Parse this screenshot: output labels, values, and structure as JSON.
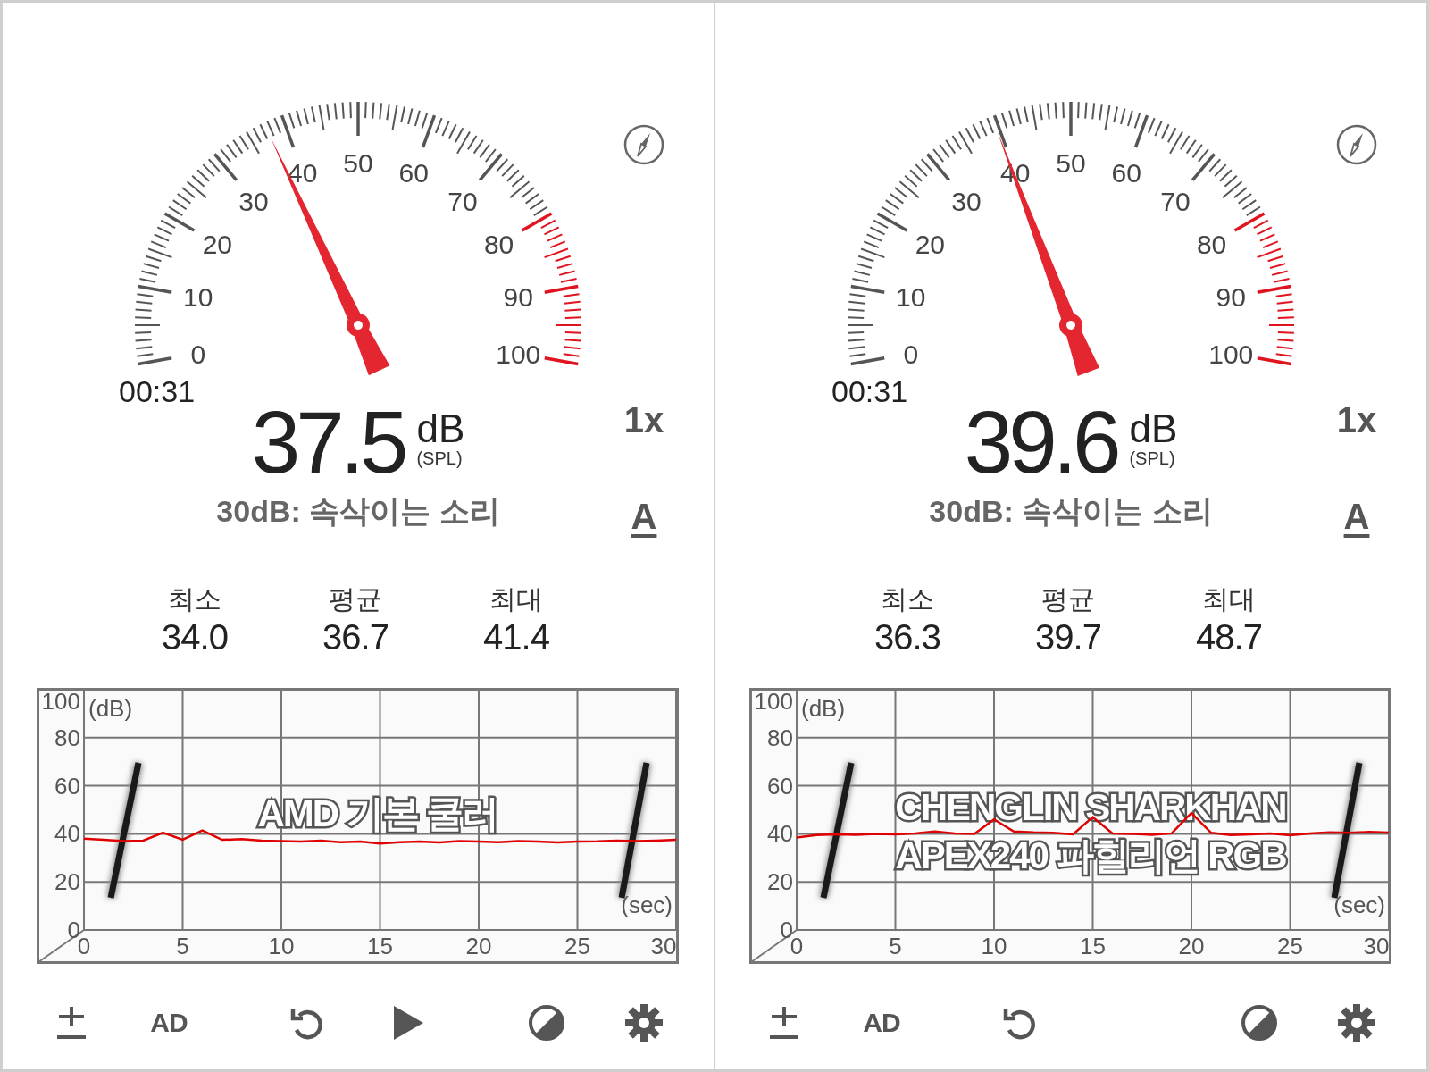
{
  "panels": [
    {
      "timer": "00:31",
      "gauge": {
        "level": 0.375,
        "labels": [
          "50",
          "40",
          "60",
          "30",
          "70",
          "20",
          "80",
          "10",
          "90",
          "0",
          "100"
        ]
      },
      "reading": "37.5",
      "unit": "dB",
      "unit_note": "(SPL)",
      "reference": "30dB: 속삭이는 소리",
      "zoom": "1x",
      "weighting": "A",
      "stats": [
        {
          "label": "최소",
          "value": "34.0"
        },
        {
          "label": "평균",
          "value": "36.7"
        },
        {
          "label": "최대",
          "value": "41.4"
        }
      ],
      "chart": {
        "annotation": [
          "AMD 기본 쿨러"
        ],
        "chart_data": {
          "type": "line",
          "xlabel": "(sec)",
          "ylabel": "(dB)",
          "x": [
            0,
            1,
            2,
            3,
            4,
            5,
            6,
            7,
            8,
            9,
            10,
            11,
            12,
            13,
            14,
            15,
            16,
            17,
            18,
            19,
            20,
            21,
            22,
            23,
            24,
            25,
            26,
            27,
            28,
            29,
            30
          ],
          "xlim": [
            0,
            30
          ],
          "ylim": [
            0,
            100
          ],
          "xticks": [
            0,
            5,
            10,
            15,
            20,
            25,
            30
          ],
          "yticks": [
            0,
            20,
            40,
            60,
            80,
            100
          ],
          "grid": true,
          "series": [
            {
              "color": "#e00000",
              "values": [
                38,
                37.5,
                37,
                37.2,
                40.5,
                37.6,
                41.4,
                37.5,
                37.8,
                37.2,
                37,
                36.8,
                37.2,
                36.5,
                36.8,
                36,
                36.5,
                36.8,
                36.4,
                37,
                36.8,
                36.5,
                37,
                36.8,
                36.4,
                36.8,
                36.9,
                37.2,
                37,
                37.2,
                37.5
              ]
            }
          ]
        }
      },
      "toolbar": [
        {
          "kind": "plus-minus"
        },
        {
          "kind": "ad",
          "label": "AD"
        },
        {
          "kind": "reset"
        },
        {
          "kind": "play"
        },
        {
          "kind": "contrast"
        },
        {
          "kind": "settings"
        }
      ]
    },
    {
      "timer": "00:31",
      "gauge": {
        "level": 0.396,
        "labels": [
          "50",
          "40",
          "60",
          "30",
          "70",
          "20",
          "80",
          "10",
          "90",
          "0",
          "100"
        ]
      },
      "reading": "39.6",
      "unit": "dB",
      "unit_note": "(SPL)",
      "reference": "30dB: 속삭이는 소리",
      "zoom": "1x",
      "weighting": "A",
      "stats": [
        {
          "label": "최소",
          "value": "36.3"
        },
        {
          "label": "평균",
          "value": "39.7"
        },
        {
          "label": "최대",
          "value": "48.7"
        }
      ],
      "chart": {
        "annotation": [
          "CHENGLIN SHARKHAN",
          "APEX240 파힐리언 RGB"
        ],
        "chart_data": {
          "type": "line",
          "xlabel": "(sec)",
          "ylabel": "(dB)",
          "x": [
            0,
            1,
            2,
            3,
            4,
            5,
            6,
            7,
            8,
            9,
            10,
            11,
            12,
            13,
            14,
            15,
            16,
            17,
            18,
            19,
            20,
            21,
            22,
            23,
            24,
            25,
            26,
            27,
            28,
            29,
            30
          ],
          "xlim": [
            0,
            30
          ],
          "ylim": [
            0,
            100
          ],
          "xticks": [
            0,
            5,
            10,
            15,
            20,
            25,
            30
          ],
          "yticks": [
            0,
            20,
            40,
            60,
            80,
            100
          ],
          "grid": true,
          "series": [
            {
              "color": "#e00000",
              "values": [
                38.5,
                39.5,
                39.8,
                39.6,
                40,
                39.8,
                40.2,
                41,
                40.2,
                40,
                46,
                41,
                40.6,
                40.4,
                39.8,
                47,
                40.2,
                40,
                39.6,
                40.2,
                48.7,
                40.4,
                39.5,
                39.8,
                40.2,
                39.4,
                40.2,
                40.6,
                40.4,
                40.8,
                40.5
              ]
            }
          ]
        }
      },
      "toolbar": [
        {
          "kind": "plus-minus"
        },
        {
          "kind": "ad",
          "label": "AD"
        },
        {
          "kind": "reset"
        },
        {
          "kind": "contrast"
        },
        {
          "kind": "settings"
        }
      ]
    }
  ]
}
